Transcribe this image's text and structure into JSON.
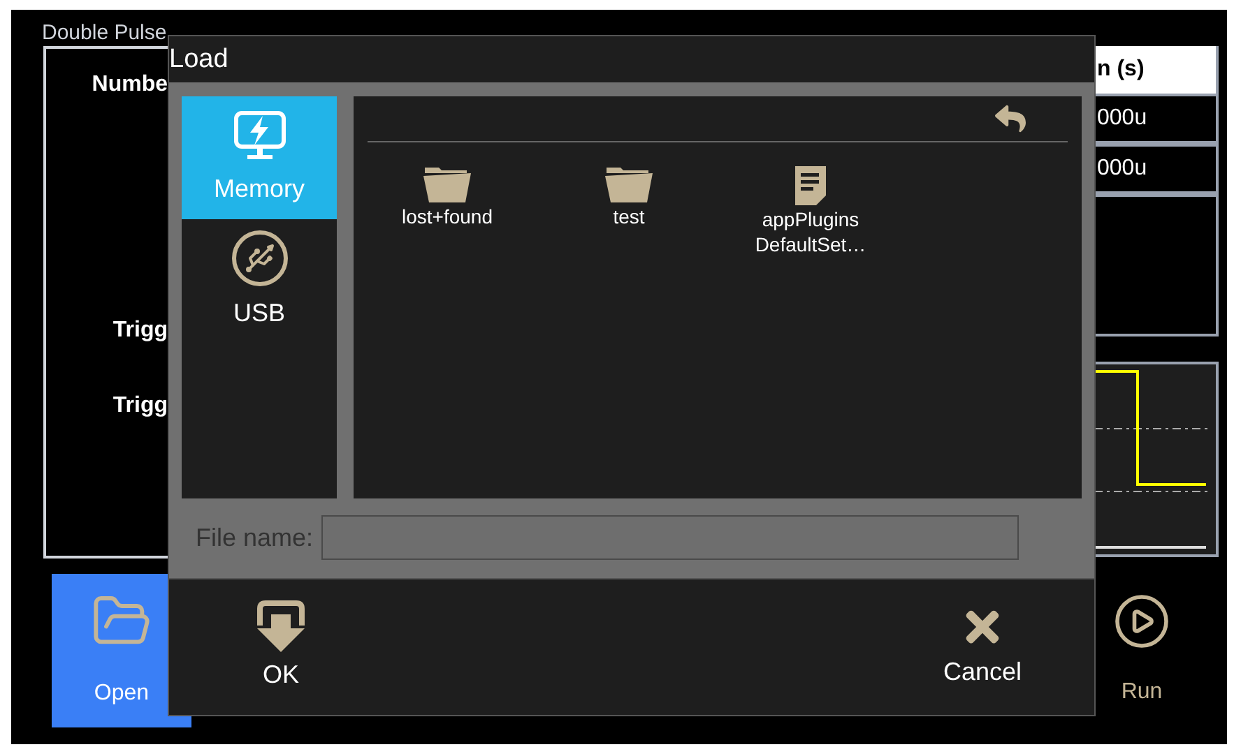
{
  "screen": {
    "title": "Double Pulse"
  },
  "background_panel": {
    "labels": [
      "Numbe",
      "Trigg",
      "Trigg"
    ]
  },
  "table": {
    "header": "n (s)",
    "rows": [
      "000u",
      "000u"
    ]
  },
  "bottom_buttons": [
    {
      "label": "Open",
      "selected": true,
      "kind": "open"
    },
    {
      "label": "Run",
      "selected": false,
      "kind": "run"
    }
  ],
  "dialog": {
    "title": "Load",
    "sources": [
      {
        "label": "Memory",
        "selected": true,
        "kind": "memory"
      },
      {
        "label": "USB",
        "selected": false,
        "kind": "usb"
      }
    ],
    "files": [
      {
        "lines": [
          "lost+found"
        ],
        "kind": "folder"
      },
      {
        "lines": [
          "test"
        ],
        "kind": "folder"
      },
      {
        "lines": [
          "appPlugins",
          "DefaultSet…"
        ],
        "kind": "file"
      }
    ],
    "file_name": {
      "label": "File name:"
    },
    "buttons": [
      {
        "label": "OK",
        "kind": "ok"
      },
      {
        "label": "Cancel",
        "kind": "cancel"
      }
    ]
  }
}
